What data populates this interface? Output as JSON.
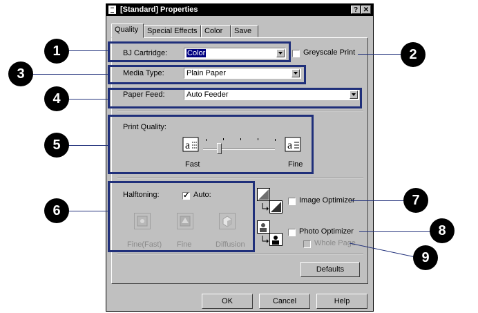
{
  "window": {
    "title": "[Standard] Properties",
    "help_btn": "?",
    "close_btn": "✕"
  },
  "tabs": [
    {
      "label": "Quality",
      "active": true
    },
    {
      "label": "Special Effects",
      "active": false
    },
    {
      "label": "Color",
      "active": false
    },
    {
      "label": "Save",
      "active": false
    }
  ],
  "quality": {
    "cartridge_label": "BJ Cartridge:",
    "cartridge_value": "Color",
    "greyscale_label": "Greyscale Print",
    "media_label": "Media Type:",
    "media_value": "Plain Paper",
    "feed_label": "Paper Feed:",
    "feed_value": "Auto Feeder",
    "print_quality_label": "Print Quality:",
    "slider_min_label": "Fast",
    "slider_max_label": "Fine",
    "halftoning_label": "Halftoning:",
    "auto_label": "Auto:",
    "halftone_options": [
      "Fine(Fast)",
      "Fine",
      "Diffusion"
    ],
    "image_optimizer_label": "Image Optimizer",
    "photo_optimizer_label": "Photo Optimizer",
    "whole_page_label": "Whole Page",
    "defaults_label": "Defaults"
  },
  "buttons": {
    "ok": "OK",
    "cancel": "Cancel",
    "help": "Help"
  },
  "callouts": [
    "1",
    "2",
    "3",
    "4",
    "5",
    "6",
    "7",
    "8",
    "9"
  ],
  "colors": {
    "highlight_box": "#1f2f7a",
    "selection": "#000080",
    "dialog_face": "#c0c0c0"
  }
}
